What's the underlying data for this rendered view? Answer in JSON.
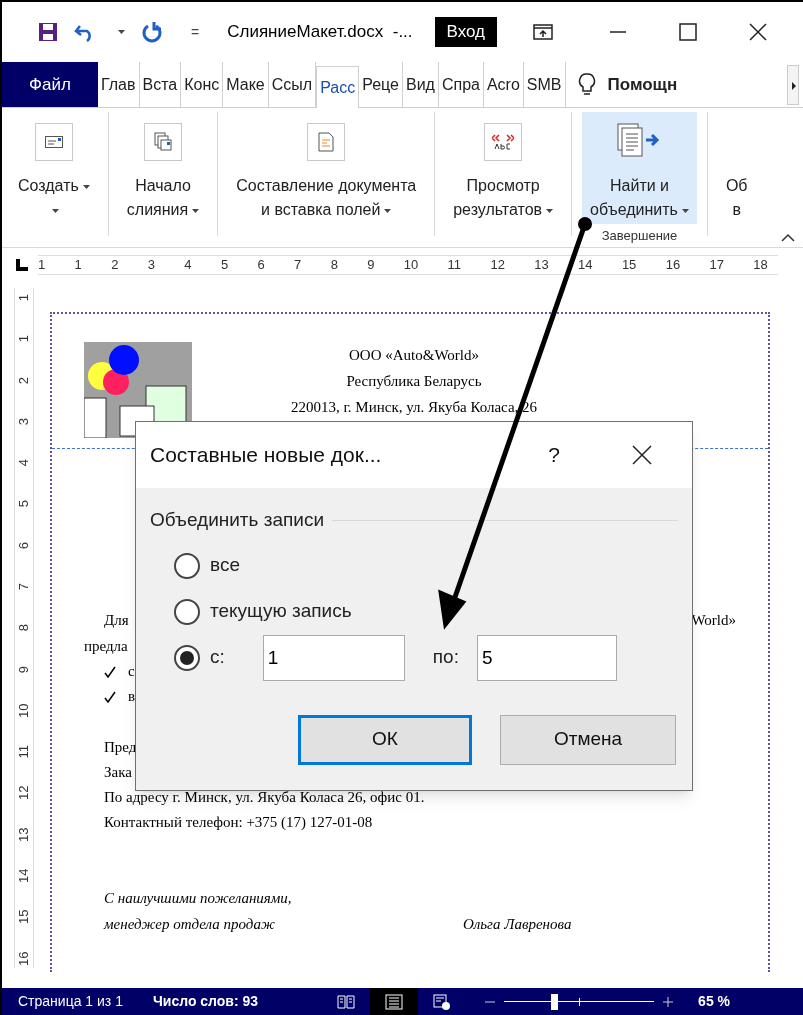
{
  "title_bar": {
    "title": "СлияниеМакет.docx  -...",
    "customize": "=",
    "sign_in": "Вход"
  },
  "tabs": [
    {
      "label": "Файл",
      "kind": "file",
      "selected": false
    },
    {
      "label": "Глав",
      "kind": "tab",
      "selected": false
    },
    {
      "label": "Вста",
      "kind": "tab",
      "selected": false
    },
    {
      "label": "Конс",
      "kind": "tab",
      "selected": false
    },
    {
      "label": "Маке",
      "kind": "tab",
      "selected": false
    },
    {
      "label": "Ссыл",
      "kind": "tab",
      "selected": false
    },
    {
      "label": "Расс",
      "kind": "tab",
      "selected": true
    },
    {
      "label": "Реце",
      "kind": "tab",
      "selected": false
    },
    {
      "label": "Вид",
      "kind": "tab",
      "selected": false
    },
    {
      "label": "Спра",
      "kind": "tab",
      "selected": false
    },
    {
      "label": "Acro",
      "kind": "tab",
      "selected": false
    },
    {
      "label": "SMB",
      "kind": "tab",
      "selected": false
    },
    {
      "label": "Помощн",
      "kind": "help",
      "selected": false
    }
  ],
  "ribbon": {
    "buttons": [
      {
        "kind": "envelope",
        "lines": [
          "Создать"
        ],
        "highlighted": false
      },
      {
        "kind": "documents",
        "lines": [
          "Начало",
          "слияния"
        ],
        "highlighted": false
      },
      {
        "kind": "document",
        "lines": [
          "Составление документа",
          "и вставка полей"
        ],
        "highlighted": false
      },
      {
        "kind": "abc",
        "lines": [
          "Просмотр",
          "результатов"
        ],
        "highlighted": false
      },
      {
        "kind": "finish",
        "lines": [
          "Найти и",
          "объединить"
        ],
        "highlighted": true,
        "group": "Завершение"
      },
      {
        "kind": "partial",
        "lines": [
          "Об",
          "в"
        ],
        "highlighted": false
      }
    ]
  },
  "ruler": {
    "marks": [
      "1",
      "1",
      "2",
      "3",
      "4",
      "5",
      "6",
      "7",
      "8",
      "9",
      "10",
      "11",
      "12",
      "13",
      "14",
      "15",
      "16",
      "17",
      "18"
    ],
    "vertical": [
      "1",
      "1",
      "2",
      "3",
      "4",
      "5",
      "6",
      "7",
      "8",
      "9",
      "10",
      "11",
      "12",
      "13",
      "14",
      "15",
      "16"
    ]
  },
  "document": {
    "header": [
      "ООО «Auto&World»",
      "Республика Беларусь",
      "220013, г. Минск, ул. Якуба Коласа, 26"
    ],
    "intro_left": "Для",
    "intro_right": "World»",
    "line_2": "предла",
    "bullets": [
      "с",
      "в"
    ],
    "lines": [
      "Пред",
      "Зака",
      "По адресу г. Минск, ул. Якуба Коласа 26, офис 01.",
      "Контактный телефон: +375 (17) 127-01-08"
    ],
    "closing": [
      "С наилучшими пожеланиями,",
      "менеджер отдела продаж"
    ],
    "signature": "Ольга Лавренова"
  },
  "dialog": {
    "title": "Составные новые док...",
    "help": "?",
    "group": "Объединить записи",
    "options": [
      {
        "label": "все",
        "selected": false
      },
      {
        "label": "текущую запись",
        "selected": false
      },
      {
        "label": "с:",
        "selected": true
      }
    ],
    "from": "1",
    "to_label": "по:",
    "to": "5",
    "ok": "ОК",
    "cancel": "Отмена"
  },
  "status_bar": {
    "page": "Страница 1 из 1",
    "words": "Число слов: 93",
    "views": [
      {
        "kind": "read",
        "selected": false
      },
      {
        "kind": "print",
        "selected": true
      },
      {
        "kind": "web",
        "selected": false
      }
    ],
    "zoom": {
      "level": 0.33,
      "reading": "65 %"
    }
  }
}
